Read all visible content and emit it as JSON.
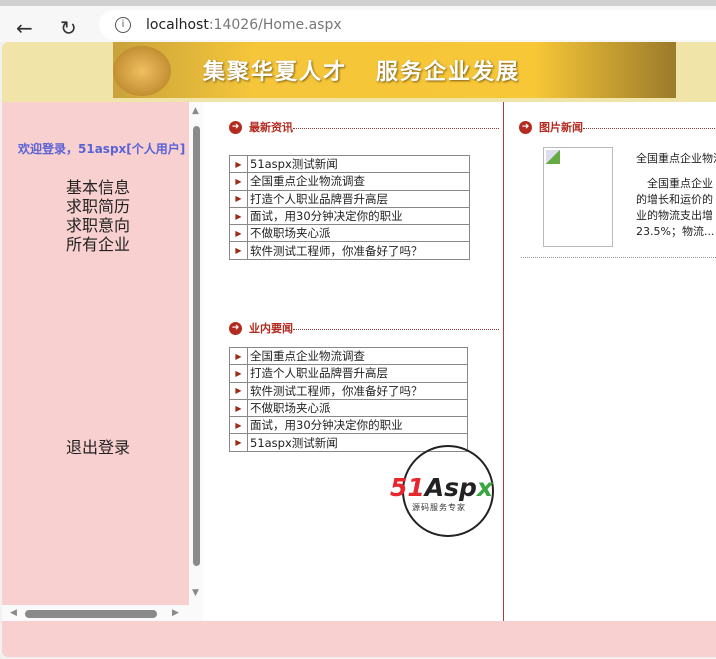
{
  "browser": {
    "url_host": "localhost",
    "url_rest": ":14026/Home.aspx"
  },
  "banner": {
    "slogan": "集聚华夏人才   服务企业发展"
  },
  "sidebar": {
    "welcome": "欢迎登录，51aspx[个人用户]",
    "items": [
      "基本信息",
      "求职简历",
      "求职意向",
      "所有企业"
    ],
    "logout": "退出登录"
  },
  "latest": {
    "title": "最新资讯",
    "items": [
      "51aspx测试新闻",
      "全国重点企业物流调查",
      "打造个人职业品牌晋升高层",
      "面试，用30分钟决定你的职业",
      "不做职场夹心派",
      "软件测试工程师，你准备好了吗？"
    ]
  },
  "industry": {
    "title": "业内要闻",
    "items": [
      "全国重点企业物流调查",
      "打造个人职业品牌晋升高层",
      "软件测试工程师，你准备好了吗？",
      "不做职场夹心派",
      "面试，用30分钟决定你的职业",
      "51aspx测试新闻"
    ]
  },
  "picnews": {
    "title": "图片新闻",
    "headline": "全国重点企业物流调查",
    "body": [
      "　全国重点企业",
      "的增长和运价的",
      "业的物流支出增",
      "23.5%；物流..."
    ]
  },
  "watermark": {
    "brand_a": "51",
    "brand_b": "Asp",
    "brand_c": "x",
    "tagline": "源码服务专家"
  }
}
